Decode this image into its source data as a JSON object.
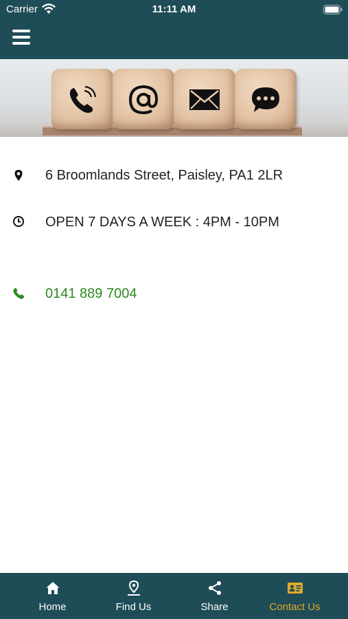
{
  "status_bar": {
    "carrier": "Carrier",
    "time": "11:11 AM"
  },
  "nav": {
    "menu_icon": "hamburger-menu-icon"
  },
  "banner": {
    "icons": [
      "phone-icon",
      "at-sign-icon",
      "envelope-icon",
      "chat-bubble-icon"
    ]
  },
  "contact": {
    "address": "6 Broomlands Street, Paisley, PA1 2LR",
    "hours": "OPEN 7 DAYS A WEEK : 4PM - 10PM",
    "phone": "0141 889 7004"
  },
  "tabs": [
    {
      "label": "Home",
      "icon": "home-icon"
    },
    {
      "label": "Find Us",
      "icon": "location-pin-icon"
    },
    {
      "label": "Share",
      "icon": "share-icon"
    },
    {
      "label": "Contact Us",
      "icon": "contact-card-icon",
      "active": true
    }
  ],
  "colors": {
    "primary": "#1e4d57",
    "accent": "#e1a92b",
    "phone_link": "#2a8a1d"
  }
}
